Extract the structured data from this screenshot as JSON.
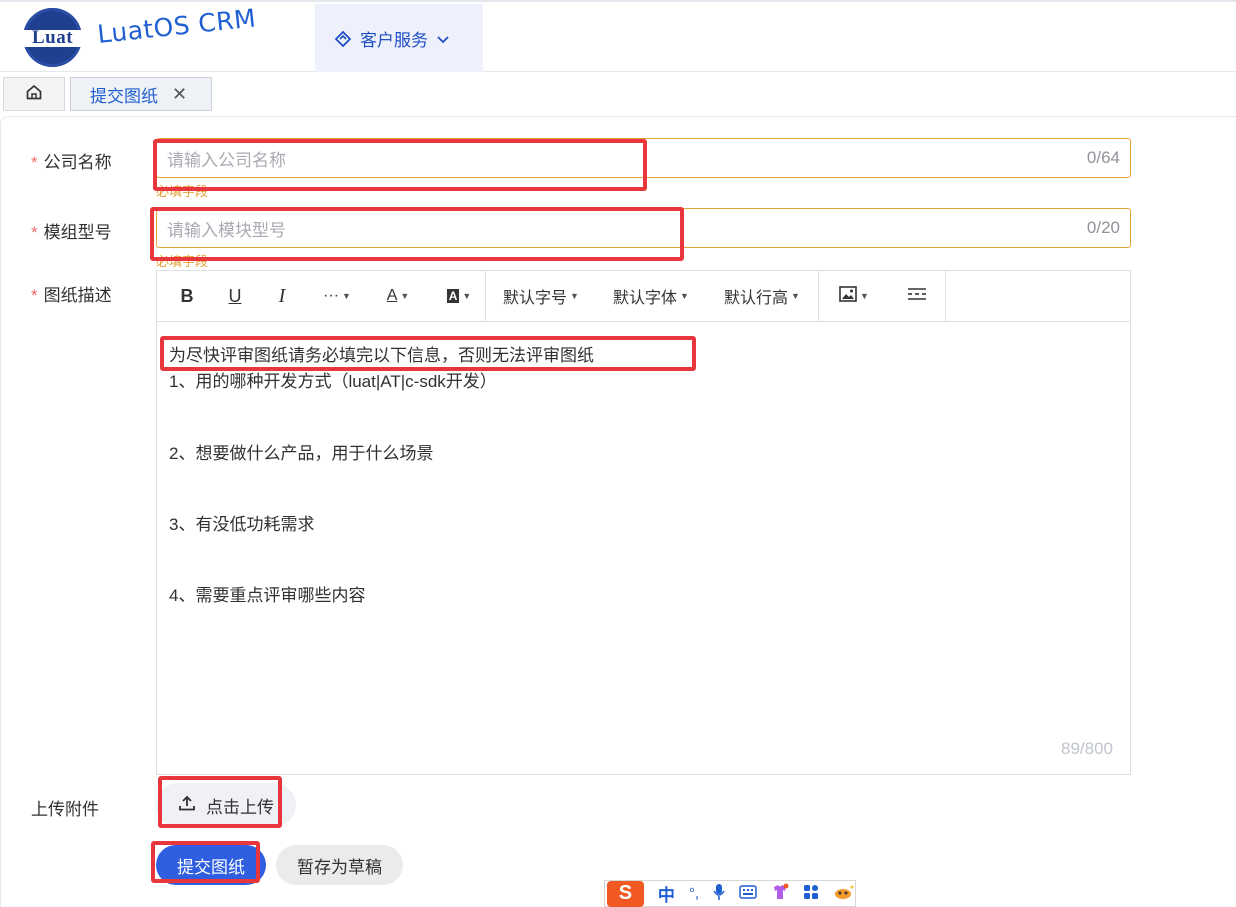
{
  "header": {
    "logo_text": "Luat",
    "brand_left": "Luat",
    "brand_mid": "OS",
    "brand_right": " CRM",
    "nav_menu_label": "客户服务"
  },
  "tabs": {
    "home_icon": "home-icon",
    "active_label": "提交图纸",
    "close_glyph": "✕"
  },
  "form": {
    "company": {
      "label": "公司名称",
      "placeholder": "请输入公司名称",
      "count": "0/64",
      "error": "必填字段"
    },
    "model": {
      "label": "模组型号",
      "placeholder": "请输入模块型号",
      "count": "0/20",
      "error": "必填字段"
    },
    "description": {
      "label": "图纸描述",
      "toolbar": {
        "bold": "B",
        "underline": "U",
        "italic": "I",
        "more": "···",
        "font_color": "A",
        "bg_color": "A",
        "font_size": "默认字号",
        "font_family": "默认字体",
        "line_height": "默认行高",
        "image_icon": "image-icon",
        "divider_icon": "divider-icon"
      },
      "lines": [
        "为尽快评审图纸请务必填完以下信息，否则无法评审图纸",
        "1、用的哪种开发方式（luat|AT|c-sdk开发）",
        "2、想要做什么产品，用于什么场景",
        "3、有没低功耗需求",
        "4、需要重点评审哪些内容"
      ],
      "count": "89/800"
    },
    "attachment": {
      "label": "上传附件",
      "button": "点击上传"
    },
    "submit": "提交图纸",
    "draft": "暂存为草稿"
  },
  "ime": {
    "logo": "S",
    "lang": "中",
    "punct": "°,",
    "icons": [
      "mic-icon",
      "keyboard-icon",
      "skin-icon",
      "apps-icon",
      "mascot-icon"
    ]
  },
  "colors": {
    "primary": "#2f5fe0",
    "warning": "#e6a23c",
    "required": "#f56c6c",
    "annotation": "#e8363d"
  }
}
